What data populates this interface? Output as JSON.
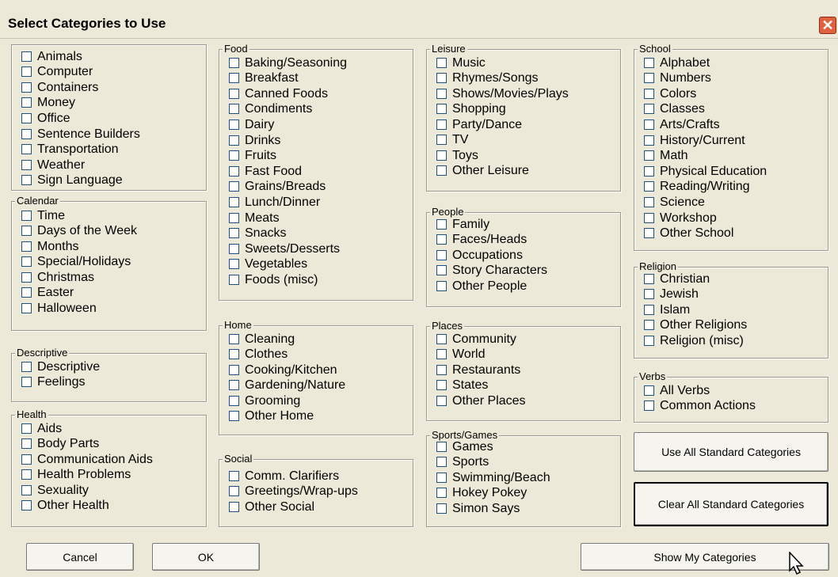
{
  "dialog": {
    "title": "Select Categories to Use",
    "close_label": "✕"
  },
  "groups": {
    "general": {
      "title": "",
      "items": [
        "Animals",
        "Computer",
        "Containers",
        "Money",
        "Office",
        "Sentence Builders",
        "Transportation",
        "Weather",
        "Sign Language"
      ]
    },
    "calendar": {
      "title": "Calendar",
      "items": [
        "Time",
        "Days of the Week",
        "Months",
        "Special/Holidays",
        "Christmas",
        "Easter",
        "Halloween"
      ]
    },
    "descriptive": {
      "title": "Descriptive",
      "items": [
        "Descriptive",
        "Feelings"
      ]
    },
    "health": {
      "title": "Health",
      "items": [
        "Aids",
        "Body Parts",
        "Communication Aids",
        "Health Problems",
        "Sexuality",
        "Other Health"
      ]
    },
    "food": {
      "title": "Food",
      "items": [
        "Baking/Seasoning",
        "Breakfast",
        "Canned Foods",
        "Condiments",
        "Dairy",
        "Drinks",
        "Fruits",
        "Fast Food",
        "Grains/Breads",
        "Lunch/Dinner",
        "Meats",
        "Snacks",
        "Sweets/Desserts",
        "Vegetables",
        "Foods (misc)"
      ]
    },
    "home": {
      "title": "Home",
      "items": [
        "Cleaning",
        "Clothes",
        "Cooking/Kitchen",
        "Gardening/Nature",
        "Grooming",
        "Other Home"
      ]
    },
    "social": {
      "title": "Social",
      "items": [
        "Comm. Clarifiers",
        "Greetings/Wrap-ups",
        "Other Social"
      ]
    },
    "leisure": {
      "title": "Leisure",
      "items": [
        "Music",
        "Rhymes/Songs",
        "Shows/Movies/Plays",
        "Shopping",
        "Party/Dance",
        "TV",
        "Toys",
        "Other Leisure"
      ]
    },
    "people": {
      "title": "People",
      "items": [
        "Family",
        "Faces/Heads",
        "Occupations",
        "Story Characters",
        "Other People"
      ]
    },
    "places": {
      "title": "Places",
      "items": [
        "Community",
        "World",
        "Restaurants",
        "States",
        "Other Places"
      ]
    },
    "sports": {
      "title": "Sports/Games",
      "items": [
        "Games",
        "Sports",
        "Swimming/Beach",
        "Hokey Pokey",
        "Simon Says"
      ]
    },
    "school": {
      "title": "School",
      "items": [
        "Alphabet",
        "Numbers",
        "Colors",
        "Classes",
        "Arts/Crafts",
        "History/Current",
        "Math",
        "Physical Education",
        "Reading/Writing",
        "Science",
        "Workshop",
        "Other School"
      ]
    },
    "religion": {
      "title": "Religion",
      "items": [
        "Christian",
        "Jewish",
        "Islam",
        "Other Religions",
        "Religion (misc)"
      ]
    },
    "verbs": {
      "title": "Verbs",
      "items": [
        "All Verbs",
        "Common Actions"
      ]
    }
  },
  "buttons": {
    "use_all": "Use All Standard Categories",
    "clear_all": "Clear All Standard Categories",
    "cancel": "Cancel",
    "ok": "OK",
    "show_my": "Show My Categories"
  }
}
